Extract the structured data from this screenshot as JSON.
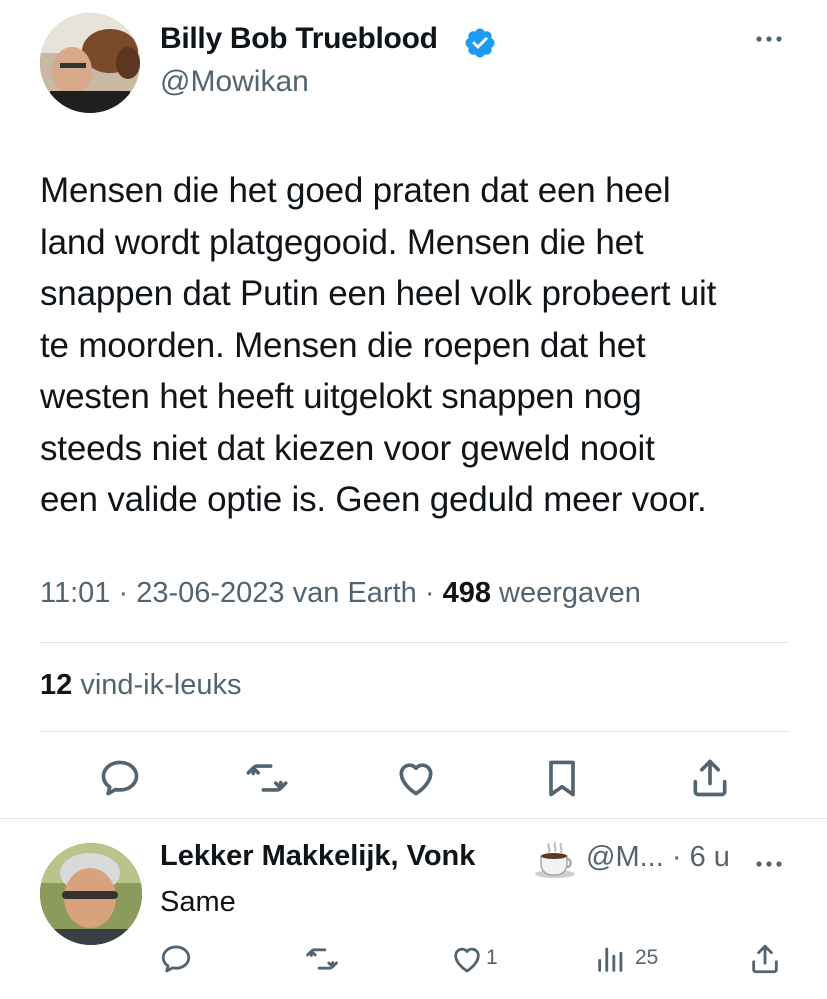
{
  "tweet": {
    "author_name": "Billy Bob Trueblood",
    "handle": "@Mowikan",
    "text": "Mensen die het goed praten dat een heel\nland wordt platgegooid. Mensen die het\nsnappen dat Putin een heel volk probeert uit\nte moorden. Mensen die roepen dat het\nwesten het heeft uitgelokt snappen nog\nsteeds niet dat kiezen voor geweld nooit\neen valide optie is. Geen geduld meer voor.",
    "time": "11:01",
    "date": "23-06-2023",
    "source": "van Earth",
    "views_count": "498",
    "views_label": "weergaven",
    "likes_count": "12",
    "likes_label": "vind-ik-leuks",
    "separator": "·"
  },
  "reply": {
    "author_name": "Lekker Makkelijk, Vonk",
    "emoji": "coffee-icon",
    "handle": "@M...",
    "time": "6 u",
    "text": "Same",
    "like_count": "1",
    "views_count": "25"
  },
  "colors": {
    "text_primary": "#0f1419",
    "text_secondary": "#536471",
    "verified_blue": "#1d9bf0",
    "divider": "#dfe3e7"
  },
  "icons": {
    "more": "more-icon",
    "verified": "verified-badge-icon",
    "reply": "reply-icon",
    "retweet": "retweet-icon",
    "like": "heart-icon",
    "bookmark": "bookmark-icon",
    "share": "share-icon",
    "views": "views-icon"
  }
}
